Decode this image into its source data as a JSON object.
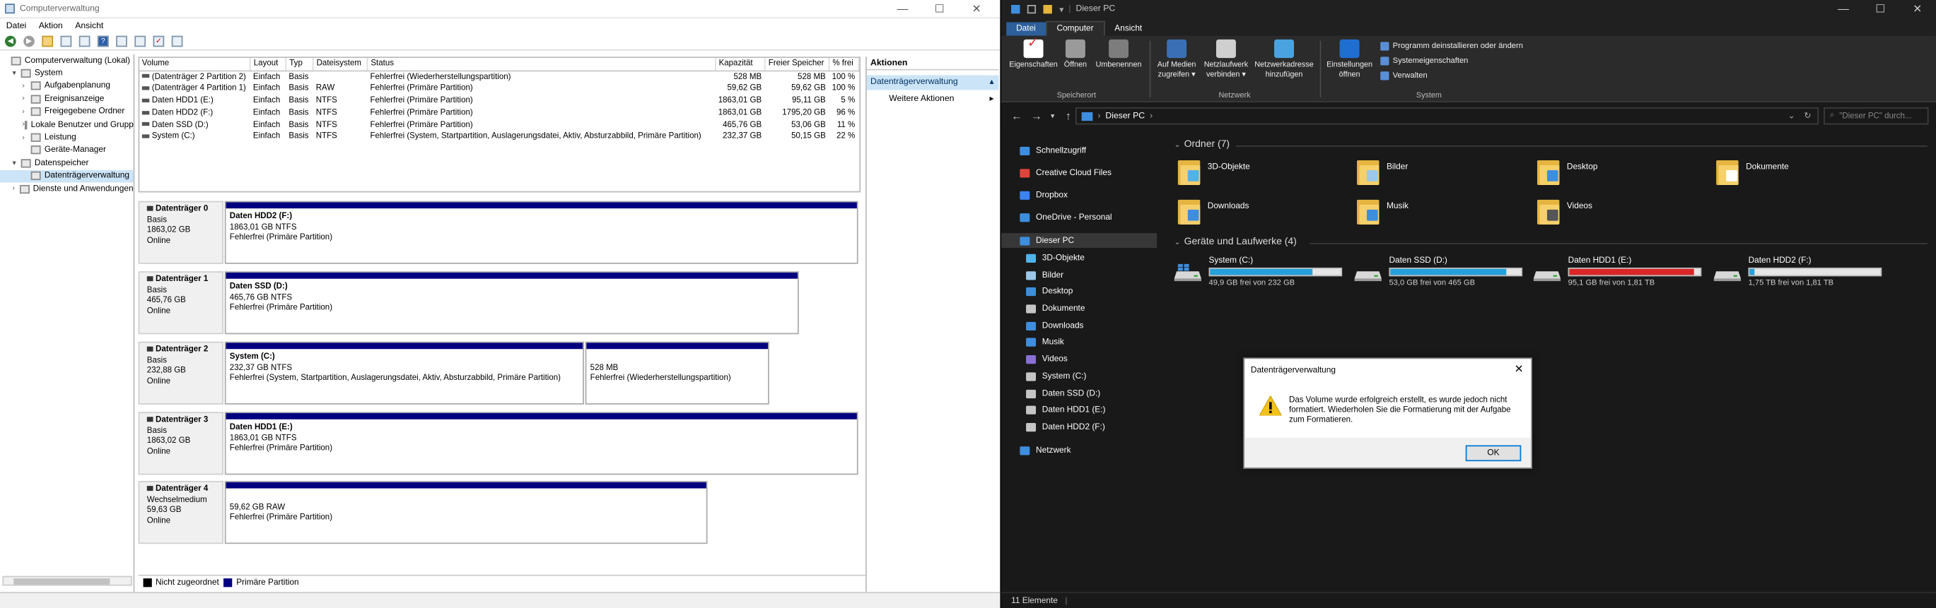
{
  "cm": {
    "title": "Computerverwaltung",
    "menu": [
      "Datei",
      "Aktion",
      "Ansicht"
    ],
    "tree": [
      {
        "label": "Computerverwaltung (Lokal)",
        "exp": "",
        "indent": 0
      },
      {
        "label": "System",
        "exp": "▾",
        "indent": 1
      },
      {
        "label": "Aufgabenplanung",
        "exp": "›",
        "indent": 2
      },
      {
        "label": "Ereignisanzeige",
        "exp": "›",
        "indent": 2
      },
      {
        "label": "Freigegebene Ordner",
        "exp": "›",
        "indent": 2
      },
      {
        "label": "Lokale Benutzer und Gruppen",
        "exp": "›",
        "indent": 2
      },
      {
        "label": "Leistung",
        "exp": "›",
        "indent": 2
      },
      {
        "label": "Geräte-Manager",
        "exp": "",
        "indent": 2
      },
      {
        "label": "Datenspeicher",
        "exp": "▾",
        "indent": 1
      },
      {
        "label": "Datenträgerverwaltung",
        "exp": "",
        "indent": 2,
        "selected": true
      },
      {
        "label": "Dienste und Anwendungen",
        "exp": "›",
        "indent": 1
      }
    ],
    "volume_headers": [
      "Volume",
      "Layout",
      "Typ",
      "Dateisystem",
      "Status",
      "Kapazität",
      "Freier Speicher",
      "% frei"
    ],
    "volumes": [
      [
        "(Datenträger 2 Partition 2)",
        "Einfach",
        "Basis",
        "",
        "Fehlerfrei (Wiederherstellungspartition)",
        "528 MB",
        "528 MB",
        "100 %"
      ],
      [
        "(Datenträger 4 Partition 1)",
        "Einfach",
        "Basis",
        "RAW",
        "Fehlerfrei (Primäre Partition)",
        "59,62 GB",
        "59,62 GB",
        "100 %"
      ],
      [
        "Daten HDD1 (E:)",
        "Einfach",
        "Basis",
        "NTFS",
        "Fehlerfrei (Primäre Partition)",
        "1863,01 GB",
        "95,11 GB",
        "5 %"
      ],
      [
        "Daten HDD2 (F:)",
        "Einfach",
        "Basis",
        "NTFS",
        "Fehlerfrei (Primäre Partition)",
        "1863,01 GB",
        "1795,20 GB",
        "96 %"
      ],
      [
        "Daten SSD (D:)",
        "Einfach",
        "Basis",
        "NTFS",
        "Fehlerfrei (Primäre Partition)",
        "465,76 GB",
        "53,06 GB",
        "11 %"
      ],
      [
        "System (C:)",
        "Einfach",
        "Basis",
        "NTFS",
        "Fehlerfrei (System, Startpartition, Auslagerungsdatei, Aktiv, Absturzabbild, Primäre Partition)",
        "232,37 GB",
        "50,15 GB",
        "22 %"
      ]
    ],
    "disks": [
      {
        "name": "Datenträger 0",
        "type": "Basis",
        "size": "1863,02 GB",
        "state": "Online",
        "parts": [
          {
            "title": "Daten HDD2  (F:)",
            "size": "1863,01 GB NTFS",
            "status": "Fehlerfrei (Primäre Partition)"
          }
        ]
      },
      {
        "name": "Datenträger 1",
        "type": "Basis",
        "size": "465,76 GB",
        "state": "Online",
        "parts": [
          {
            "title": "Daten SSD  (D:)",
            "size": "465,76 GB NTFS",
            "status": "Fehlerfrei (Primäre Partition)"
          }
        ]
      },
      {
        "name": "Datenträger 2",
        "type": "Basis",
        "size": "232,88 GB",
        "state": "Online",
        "parts": [
          {
            "title": "System  (C:)",
            "size": "232,37 GB NTFS",
            "status": "Fehlerfrei (System, Startpartition, Auslagerungsdatei, Aktiv, Absturzabbild, Primäre Partition)"
          },
          {
            "title": "",
            "size": "528 MB",
            "status": "Fehlerfrei (Wiederherstellungspartition)"
          }
        ]
      },
      {
        "name": "Datenträger 3",
        "type": "Basis",
        "size": "1863,02 GB",
        "state": "Online",
        "parts": [
          {
            "title": "Daten HDD1  (E:)",
            "size": "1863,01 GB NTFS",
            "status": "Fehlerfrei (Primäre Partition)"
          }
        ]
      },
      {
        "name": "Datenträger 4",
        "type": "Wechselmedium",
        "size": "59,63 GB",
        "state": "Online",
        "parts": [
          {
            "title": "",
            "size": "59,62 GB RAW",
            "status": "Fehlerfrei (Primäre Partition)"
          }
        ]
      }
    ],
    "legend": [
      {
        "label": "Nicht zugeordnet",
        "color": "#000000"
      },
      {
        "label": "Primäre Partition",
        "color": "#000080"
      }
    ],
    "actions": {
      "header": "Aktionen",
      "section": "Datenträgerverwaltung",
      "more": "Weitere Aktionen"
    }
  },
  "ex": {
    "title": "Dieser PC",
    "tabs": {
      "file": "Datei",
      "computer": "Computer",
      "view": "Ansicht"
    },
    "ribbon": {
      "properties": "Eigenschaften",
      "open": "Öffnen",
      "rename": "Umbenennen",
      "media_access": "Auf Medien\nzugreifen ▾",
      "map_drive": "Netzlaufwerk\nverbinden ▾",
      "add_netloc": "Netzwerkadresse\nhinzufügen",
      "settings": "Einstellungen\nöffnen",
      "uninstall": "Programm deinstallieren oder ändern",
      "sysprops": "Systemeigenschaften",
      "manage": "Verwalten",
      "group_location": "Speicherort",
      "group_network": "Netzwerk",
      "group_system": "System"
    },
    "address": {
      "path": "Dieser PC",
      "search_placeholder": "\"Dieser PC\" durch..."
    },
    "nav": [
      {
        "label": "Schnellzugriff",
        "color": "#3e8ede",
        "indent": 0
      },
      {
        "label": "Creative Cloud Files",
        "color": "#e0433b",
        "indent": 0
      },
      {
        "label": "Dropbox",
        "color": "#3b82f6",
        "indent": 0
      },
      {
        "label": "OneDrive - Personal",
        "color": "#3e8ede",
        "indent": 0
      },
      {
        "label": "Dieser PC",
        "color": "#3e8ede",
        "indent": 0,
        "selected": true
      },
      {
        "label": "3D-Objekte",
        "color": "#4fb3e8",
        "indent": 1
      },
      {
        "label": "Bilder",
        "color": "#9cc7ea",
        "indent": 1
      },
      {
        "label": "Desktop",
        "color": "#3e8ede",
        "indent": 1
      },
      {
        "label": "Dokumente",
        "color": "#c5c5c5",
        "indent": 1
      },
      {
        "label": "Downloads",
        "color": "#3e8ede",
        "indent": 1
      },
      {
        "label": "Musik",
        "color": "#3e8ede",
        "indent": 1
      },
      {
        "label": "Videos",
        "color": "#8a6fd6",
        "indent": 1
      },
      {
        "label": "System (C:)",
        "color": "#c5c5c5",
        "indent": 1
      },
      {
        "label": "Daten SSD (D:)",
        "color": "#c5c5c5",
        "indent": 1
      },
      {
        "label": "Daten HDD1 (E:)",
        "color": "#c5c5c5",
        "indent": 1
      },
      {
        "label": "Daten HDD2 (F:)",
        "color": "#c5c5c5",
        "indent": 1
      },
      {
        "label": "Netzwerk",
        "color": "#3e8ede",
        "indent": 0
      }
    ],
    "folders_header": "Ordner (7)",
    "folders": [
      {
        "label": "3D-Objekte",
        "badge": "#4fb3e8"
      },
      {
        "label": "Bilder",
        "badge": "#9cc7ea"
      },
      {
        "label": "Desktop",
        "badge": "#3e8ede"
      },
      {
        "label": "Dokumente",
        "badge": "#ffffff"
      },
      {
        "label": "Downloads",
        "badge": "#3e8ede"
      },
      {
        "label": "Musik",
        "badge": "#3e8ede"
      },
      {
        "label": "Videos",
        "badge": "#555555"
      }
    ],
    "drives_header": "Geräte und Laufwerke (4)",
    "drives": [
      {
        "name": "System (C:)",
        "free": "49,9 GB frei von 232 GB",
        "used_fraction": 0.785,
        "color": "#26a0da"
      },
      {
        "name": "Daten SSD (D:)",
        "free": "53,0 GB frei von 465 GB",
        "used_fraction": 0.886,
        "color": "#26a0da"
      },
      {
        "name": "Daten HDD1 (E:)",
        "free": "95,1 GB frei von 1,81 TB",
        "used_fraction": 0.949,
        "color": "#da2626"
      },
      {
        "name": "Daten HDD2 (F:)",
        "free": "1,75 TB frei von 1,81 TB",
        "used_fraction": 0.036,
        "color": "#26a0da"
      }
    ],
    "status": "11 Elemente"
  },
  "dialog": {
    "title": "Datenträgerverwaltung",
    "message": "Das Volume wurde erfolgreich erstellt, es wurde jedoch nicht formatiert. Wiederholen Sie die Formatierung mit der Aufgabe zum Formatieren.",
    "ok": "OK"
  }
}
